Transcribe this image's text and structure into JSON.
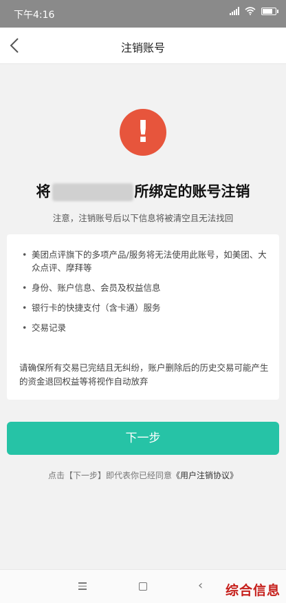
{
  "status_bar": {
    "time": "下午4:16",
    "battery_level_pct": 80
  },
  "nav": {
    "title": "注销账号"
  },
  "heading": {
    "prefix": "将",
    "suffix": "所绑定的账号注销"
  },
  "notice": "注意，注销账号后以下信息将被清空且无法找回",
  "items": [
    "美团点评旗下的多项产品/服务将无法使用此账号，如美团、大众点评、摩拜等",
    "身份、账户信息、会员及权益信息",
    "银行卡的快捷支付（含卡通）服务",
    "交易记录"
  ],
  "warning": "请确保所有交易已完结且无纠纷，账户删除后的历史交易可能产生的资金退回权益等将视作自动放弃",
  "button": {
    "label": "下一步"
  },
  "agreement": {
    "text": "点击【下一步】即代表你已经同意",
    "link": "《用户注销协议》"
  },
  "watermark": "综合信息",
  "colors": {
    "accent": "#26c3a6",
    "alert": "#e7553c",
    "watermark": "#c6201c"
  }
}
